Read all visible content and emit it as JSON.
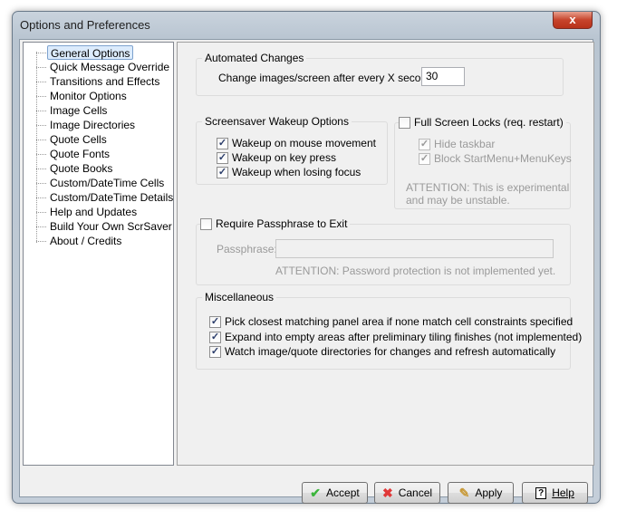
{
  "window": {
    "title": "Options and Preferences",
    "close": "x"
  },
  "tree": [
    "General Options",
    "Quick Message Override",
    "Transitions and Effects",
    "Monitor Options",
    "Image Cells",
    "Image Directories",
    "Quote Cells",
    "Quote Fonts",
    "Quote Books",
    "Custom/DateTime Cells",
    "Custom/DateTime Details",
    "Help and Updates",
    "Build Your Own ScrSaver",
    "About / Credits"
  ],
  "automated": {
    "title": "Automated Changes",
    "label": "Change images/screen after every X seconds:",
    "value": "30"
  },
  "wakeup": {
    "title": "Screensaver Wakeup Options",
    "items": [
      "Wakeup on mouse movement",
      "Wakeup on key press",
      "Wakeup when losing focus"
    ]
  },
  "locks": {
    "title": "Full Screen Locks (req. restart)",
    "items": [
      "Hide taskbar",
      "Block StartMenu+MenuKeys"
    ],
    "note1": "ATTENTION: This is experimental",
    "note2": "and may be unstable."
  },
  "pass": {
    "title": "Require Passphrase to Exit",
    "label": "Passphrase:",
    "value": "",
    "note": "ATTENTION: Password protection is not implemented yet."
  },
  "misc": {
    "title": "Miscellaneous",
    "items": [
      "Pick closest matching panel area if none match cell constraints specified",
      "Expand into empty areas after preliminary tiling finishes (not implemented)",
      "Watch image/quote directories for changes and refresh automatically"
    ]
  },
  "buttons": {
    "accept": "Accept",
    "cancel": "Cancel",
    "apply": "Apply",
    "help": "Help"
  },
  "check": "✓"
}
